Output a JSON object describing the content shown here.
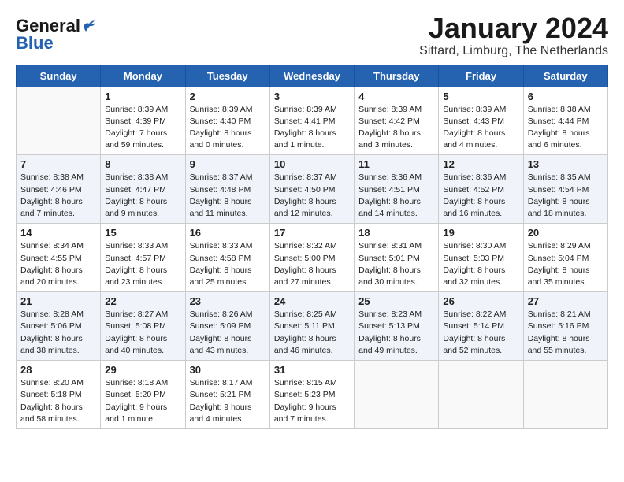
{
  "header": {
    "logo": {
      "line1": "General",
      "line2": "Blue"
    },
    "title": "January 2024",
    "location": "Sittard, Limburg, The Netherlands"
  },
  "calendar": {
    "days_of_week": [
      "Sunday",
      "Monday",
      "Tuesday",
      "Wednesday",
      "Thursday",
      "Friday",
      "Saturday"
    ],
    "weeks": [
      [
        {
          "day": "",
          "info": ""
        },
        {
          "day": "1",
          "info": "Sunrise: 8:39 AM\nSunset: 4:39 PM\nDaylight: 7 hours\nand 59 minutes."
        },
        {
          "day": "2",
          "info": "Sunrise: 8:39 AM\nSunset: 4:40 PM\nDaylight: 8 hours\nand 0 minutes."
        },
        {
          "day": "3",
          "info": "Sunrise: 8:39 AM\nSunset: 4:41 PM\nDaylight: 8 hours\nand 1 minute."
        },
        {
          "day": "4",
          "info": "Sunrise: 8:39 AM\nSunset: 4:42 PM\nDaylight: 8 hours\nand 3 minutes."
        },
        {
          "day": "5",
          "info": "Sunrise: 8:39 AM\nSunset: 4:43 PM\nDaylight: 8 hours\nand 4 minutes."
        },
        {
          "day": "6",
          "info": "Sunrise: 8:38 AM\nSunset: 4:44 PM\nDaylight: 8 hours\nand 6 minutes."
        }
      ],
      [
        {
          "day": "7",
          "info": "Sunrise: 8:38 AM\nSunset: 4:46 PM\nDaylight: 8 hours\nand 7 minutes."
        },
        {
          "day": "8",
          "info": "Sunrise: 8:38 AM\nSunset: 4:47 PM\nDaylight: 8 hours\nand 9 minutes."
        },
        {
          "day": "9",
          "info": "Sunrise: 8:37 AM\nSunset: 4:48 PM\nDaylight: 8 hours\nand 11 minutes."
        },
        {
          "day": "10",
          "info": "Sunrise: 8:37 AM\nSunset: 4:50 PM\nDaylight: 8 hours\nand 12 minutes."
        },
        {
          "day": "11",
          "info": "Sunrise: 8:36 AM\nSunset: 4:51 PM\nDaylight: 8 hours\nand 14 minutes."
        },
        {
          "day": "12",
          "info": "Sunrise: 8:36 AM\nSunset: 4:52 PM\nDaylight: 8 hours\nand 16 minutes."
        },
        {
          "day": "13",
          "info": "Sunrise: 8:35 AM\nSunset: 4:54 PM\nDaylight: 8 hours\nand 18 minutes."
        }
      ],
      [
        {
          "day": "14",
          "info": "Sunrise: 8:34 AM\nSunset: 4:55 PM\nDaylight: 8 hours\nand 20 minutes."
        },
        {
          "day": "15",
          "info": "Sunrise: 8:33 AM\nSunset: 4:57 PM\nDaylight: 8 hours\nand 23 minutes."
        },
        {
          "day": "16",
          "info": "Sunrise: 8:33 AM\nSunset: 4:58 PM\nDaylight: 8 hours\nand 25 minutes."
        },
        {
          "day": "17",
          "info": "Sunrise: 8:32 AM\nSunset: 5:00 PM\nDaylight: 8 hours\nand 27 minutes."
        },
        {
          "day": "18",
          "info": "Sunrise: 8:31 AM\nSunset: 5:01 PM\nDaylight: 8 hours\nand 30 minutes."
        },
        {
          "day": "19",
          "info": "Sunrise: 8:30 AM\nSunset: 5:03 PM\nDaylight: 8 hours\nand 32 minutes."
        },
        {
          "day": "20",
          "info": "Sunrise: 8:29 AM\nSunset: 5:04 PM\nDaylight: 8 hours\nand 35 minutes."
        }
      ],
      [
        {
          "day": "21",
          "info": "Sunrise: 8:28 AM\nSunset: 5:06 PM\nDaylight: 8 hours\nand 38 minutes."
        },
        {
          "day": "22",
          "info": "Sunrise: 8:27 AM\nSunset: 5:08 PM\nDaylight: 8 hours\nand 40 minutes."
        },
        {
          "day": "23",
          "info": "Sunrise: 8:26 AM\nSunset: 5:09 PM\nDaylight: 8 hours\nand 43 minutes."
        },
        {
          "day": "24",
          "info": "Sunrise: 8:25 AM\nSunset: 5:11 PM\nDaylight: 8 hours\nand 46 minutes."
        },
        {
          "day": "25",
          "info": "Sunrise: 8:23 AM\nSunset: 5:13 PM\nDaylight: 8 hours\nand 49 minutes."
        },
        {
          "day": "26",
          "info": "Sunrise: 8:22 AM\nSunset: 5:14 PM\nDaylight: 8 hours\nand 52 minutes."
        },
        {
          "day": "27",
          "info": "Sunrise: 8:21 AM\nSunset: 5:16 PM\nDaylight: 8 hours\nand 55 minutes."
        }
      ],
      [
        {
          "day": "28",
          "info": "Sunrise: 8:20 AM\nSunset: 5:18 PM\nDaylight: 8 hours\nand 58 minutes."
        },
        {
          "day": "29",
          "info": "Sunrise: 8:18 AM\nSunset: 5:20 PM\nDaylight: 9 hours\nand 1 minute."
        },
        {
          "day": "30",
          "info": "Sunrise: 8:17 AM\nSunset: 5:21 PM\nDaylight: 9 hours\nand 4 minutes."
        },
        {
          "day": "31",
          "info": "Sunrise: 8:15 AM\nSunset: 5:23 PM\nDaylight: 9 hours\nand 7 minutes."
        },
        {
          "day": "",
          "info": ""
        },
        {
          "day": "",
          "info": ""
        },
        {
          "day": "",
          "info": ""
        }
      ]
    ]
  }
}
